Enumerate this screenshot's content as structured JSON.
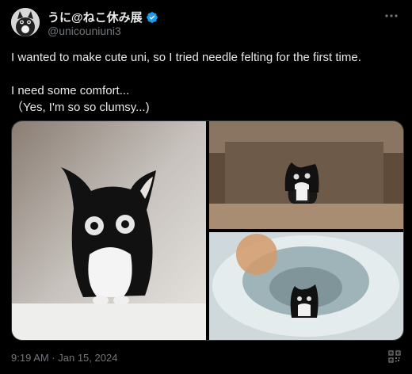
{
  "tweet": {
    "display_name": "うに@ねこ休み展",
    "handle": "@unicouniuni3",
    "text_line1": "I wanted to make cute uni, so I tried needle felting for the first time.",
    "text_line2": "I need some comfort...",
    "text_line3": "（Yes, I'm so so clumsy...)",
    "timestamp": "9:19 AM · Jan 15, 2024"
  },
  "icons": {
    "verified": "verified-badge-icon",
    "more": "more-options-icon",
    "qr": "qr-code-icon"
  },
  "colors": {
    "background": "#000000",
    "text": "#e7e9ea",
    "muted": "#71767b",
    "verified": "#1d9bf0"
  }
}
